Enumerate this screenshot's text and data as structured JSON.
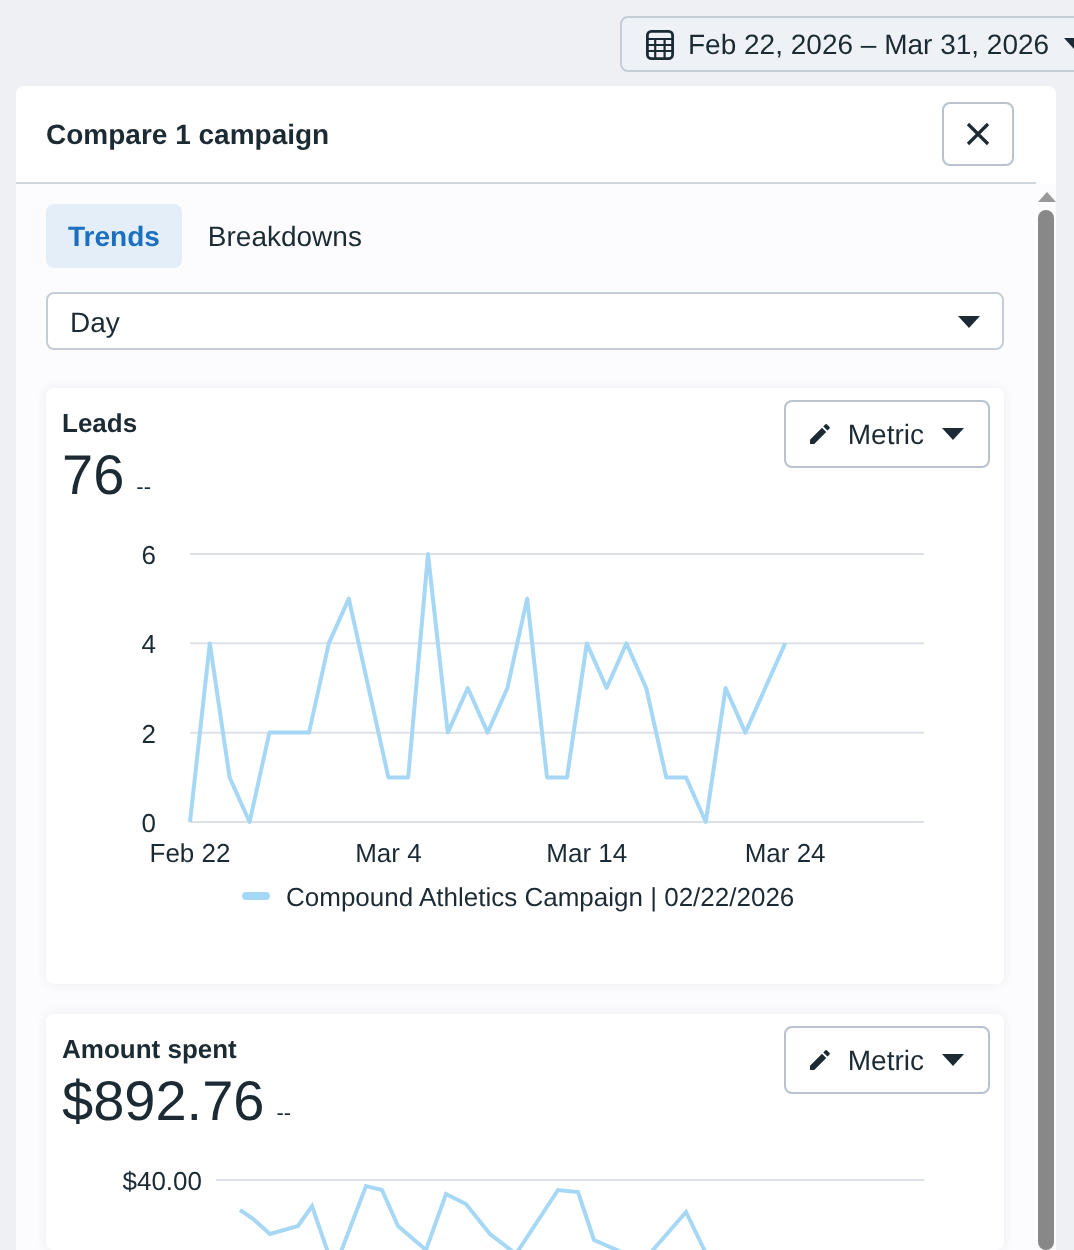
{
  "date_range": {
    "label": "Feb 22, 2026 – Mar 31, 2026"
  },
  "panel": {
    "title": "Compare 1 campaign",
    "tabs": [
      {
        "label": "Trends",
        "selected": true
      },
      {
        "label": "Breakdowns",
        "selected": false
      }
    ],
    "granularity": {
      "value": "Day"
    },
    "cards": [
      {
        "kind": "chart",
        "title": "Leads",
        "value": "76",
        "change": "--",
        "button": "Metric",
        "chart_data": {
          "type": "line",
          "categories": [
            "Feb 22",
            null,
            null,
            null,
            null,
            null,
            null,
            null,
            null,
            null,
            "Mar 4",
            null,
            null,
            null,
            null,
            null,
            null,
            null,
            null,
            null,
            "Mar 14",
            null,
            null,
            null,
            null,
            null,
            null,
            null,
            null,
            null,
            "Mar 24",
            null,
            null,
            null,
            null,
            null,
            null,
            null
          ],
          "ylim": [
            0,
            6
          ],
          "yticks": [
            0,
            2,
            4,
            6
          ],
          "series": [
            {
              "name": "Compound Athletics Campaign | 02/22/2026",
              "color": "#a6d8f5",
              "values": [
                0,
                4,
                1,
                0,
                2,
                2,
                2,
                4,
                5,
                3,
                1,
                1,
                6,
                2,
                3,
                2,
                3,
                5,
                1,
                1,
                4,
                3,
                4,
                3,
                1,
                1,
                0,
                3,
                2,
                3,
                4,
                null,
                null,
                null,
                null,
                null,
                null,
                null
              ]
            }
          ]
        }
      },
      {
        "kind": "partial",
        "title": "Amount spent",
        "value": "$892.76",
        "change": "--",
        "button": "Metric",
        "top_tick": "$40.00",
        "color": "#a6d8f5"
      }
    ]
  }
}
